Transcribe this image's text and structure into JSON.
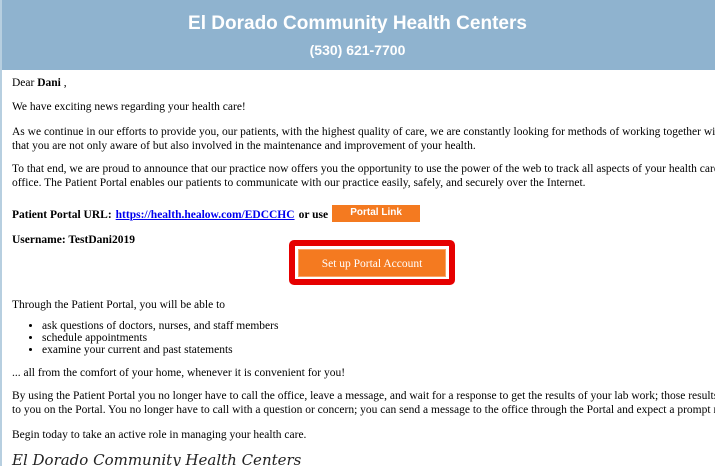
{
  "banner": {
    "org_name": "El Dorado Community Health Centers",
    "phone": "(530) 621-7700"
  },
  "letter": {
    "greeting_prefix": "Dear",
    "recipient": "Dani",
    "greeting_suffix": " ,",
    "news": "We have exciting news regarding your health care!",
    "para1_line1": "As we continue in our efforts to provide you, our patients, with the highest quality of care, we are constantly looking for methods of working together with you to ensure",
    "para1_line2": "that you are not only aware of but also involved in the maintenance and improvement of your health.",
    "para2_line1": "To that end, we are proud to announce that our practice now offers you the opportunity to use the power of the web to track all aspects of your health care through our",
    "para2_line2": "office.  The Patient Portal enables our patients to communicate with our practice easily, safely, and securely over the Internet.",
    "portal_url_label": "Patient Portal URL:",
    "portal_url": "https://health.healow.com/EDCCHC",
    "or_use": "or use",
    "portal_link_button": "Portal Link",
    "username_line": "Username: TestDani2019",
    "setup_button": "Set up Portal Account",
    "through_portal": "Through the Patient Portal, you will be able to",
    "features": [
      "ask questions of doctors, nurses, and staff members",
      "schedule appointments",
      "examine your current and past statements"
    ],
    "comfort": "... all from the comfort of your home, whenever it is convenient for you!",
    "para3_line1": "By using the Patient Portal you no longer have to call the office, leave a message, and wait for a response to get the results of your lab work; those results will be availab",
    "para3_line2": "to you on the Portal.  You no longer have to call with a question or concern; you can send a message to the office through the Portal and expect a prompt reply.",
    "closing": "Begin today to take an active role in managing your health care.",
    "signature": "El Dorado Community Health Centers"
  },
  "colors": {
    "banner_bg": "#8fb3cf",
    "accent_orange": "#f47a20",
    "highlight_red": "#e60000",
    "link_blue": "#0000ee"
  }
}
